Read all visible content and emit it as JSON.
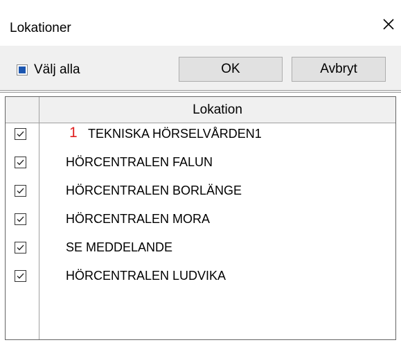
{
  "window": {
    "title": "Lokationer",
    "close_icon": "close-icon"
  },
  "toolbar": {
    "select_all_label": "Välj alla",
    "select_all_checked": true,
    "ok_label": "OK",
    "cancel_label": "Avbryt"
  },
  "grid": {
    "column_header": "Lokation",
    "rows": [
      {
        "checked": true,
        "number": "1",
        "label": "TEKNISKA HÖRSELVÅRDEN1"
      },
      {
        "checked": true,
        "label": "HÖRCENTRALEN FALUN"
      },
      {
        "checked": true,
        "label": "HÖRCENTRALEN BORLÄNGE"
      },
      {
        "checked": true,
        "label": "HÖRCENTRALEN MORA"
      },
      {
        "checked": true,
        "label": "SE MEDDELANDE"
      },
      {
        "checked": true,
        "label": "HÖRCENTRALEN LUDVIKA"
      }
    ]
  },
  "colors": {
    "accent": "#1c56b0",
    "number": "#e02020"
  }
}
